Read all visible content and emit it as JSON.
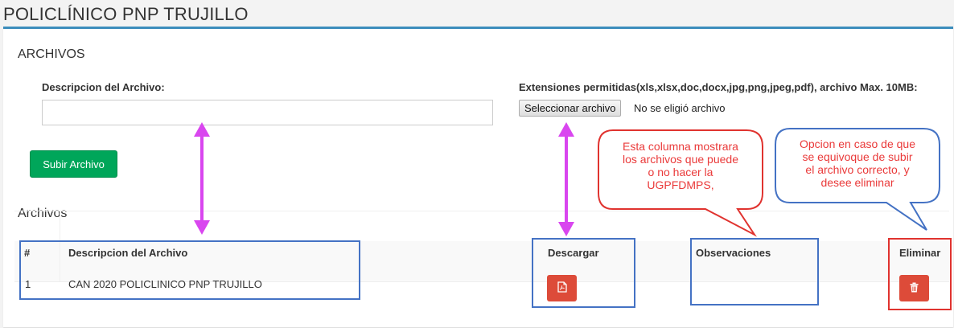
{
  "header": {
    "title": "POLICLÍNICO PNP TRUJILLO"
  },
  "upload": {
    "section_title": "ARCHIVOS",
    "description_label": "Descripcion del Archivo:",
    "description_value": "",
    "extensions_label": "Extensiones permitidas(xls,xlsx,doc,docx,jpg,png,jpeg,pdf), archivo Max. 10MB:",
    "select_file_label": "Seleccionar archivo",
    "file_status": "No se eligió archivo",
    "submit_label": "Subir Archivo"
  },
  "files": {
    "title": "Archivos",
    "columns": [
      "#",
      "Descripcion del Archivo",
      "Descargar",
      "Observaciones",
      "Eliminar"
    ],
    "rows": [
      {
        "num": "1",
        "description": "CAN 2020 POLICLINICO PNP TRUJILLO",
        "observations": ""
      }
    ]
  },
  "annotations": {
    "callout_left": [
      "Esta columna mostrara",
      "los archivos que puede",
      "o no hacer la",
      "UGPFDMPS,"
    ],
    "callout_right": [
      "Opcion en caso de que",
      "se equivoque de subir",
      "el archivo correcto, y",
      "desee eliminar"
    ],
    "arrow_color": "#d946ef",
    "callout_left_border": "#e0332f",
    "callout_right_border": "#4472c4"
  },
  "icons": {
    "download": "file-pdf-icon",
    "delete": "trash-icon"
  },
  "colors": {
    "accent": "#3c8dbc",
    "success": "#00a65a",
    "danger": "#dd4b39"
  }
}
